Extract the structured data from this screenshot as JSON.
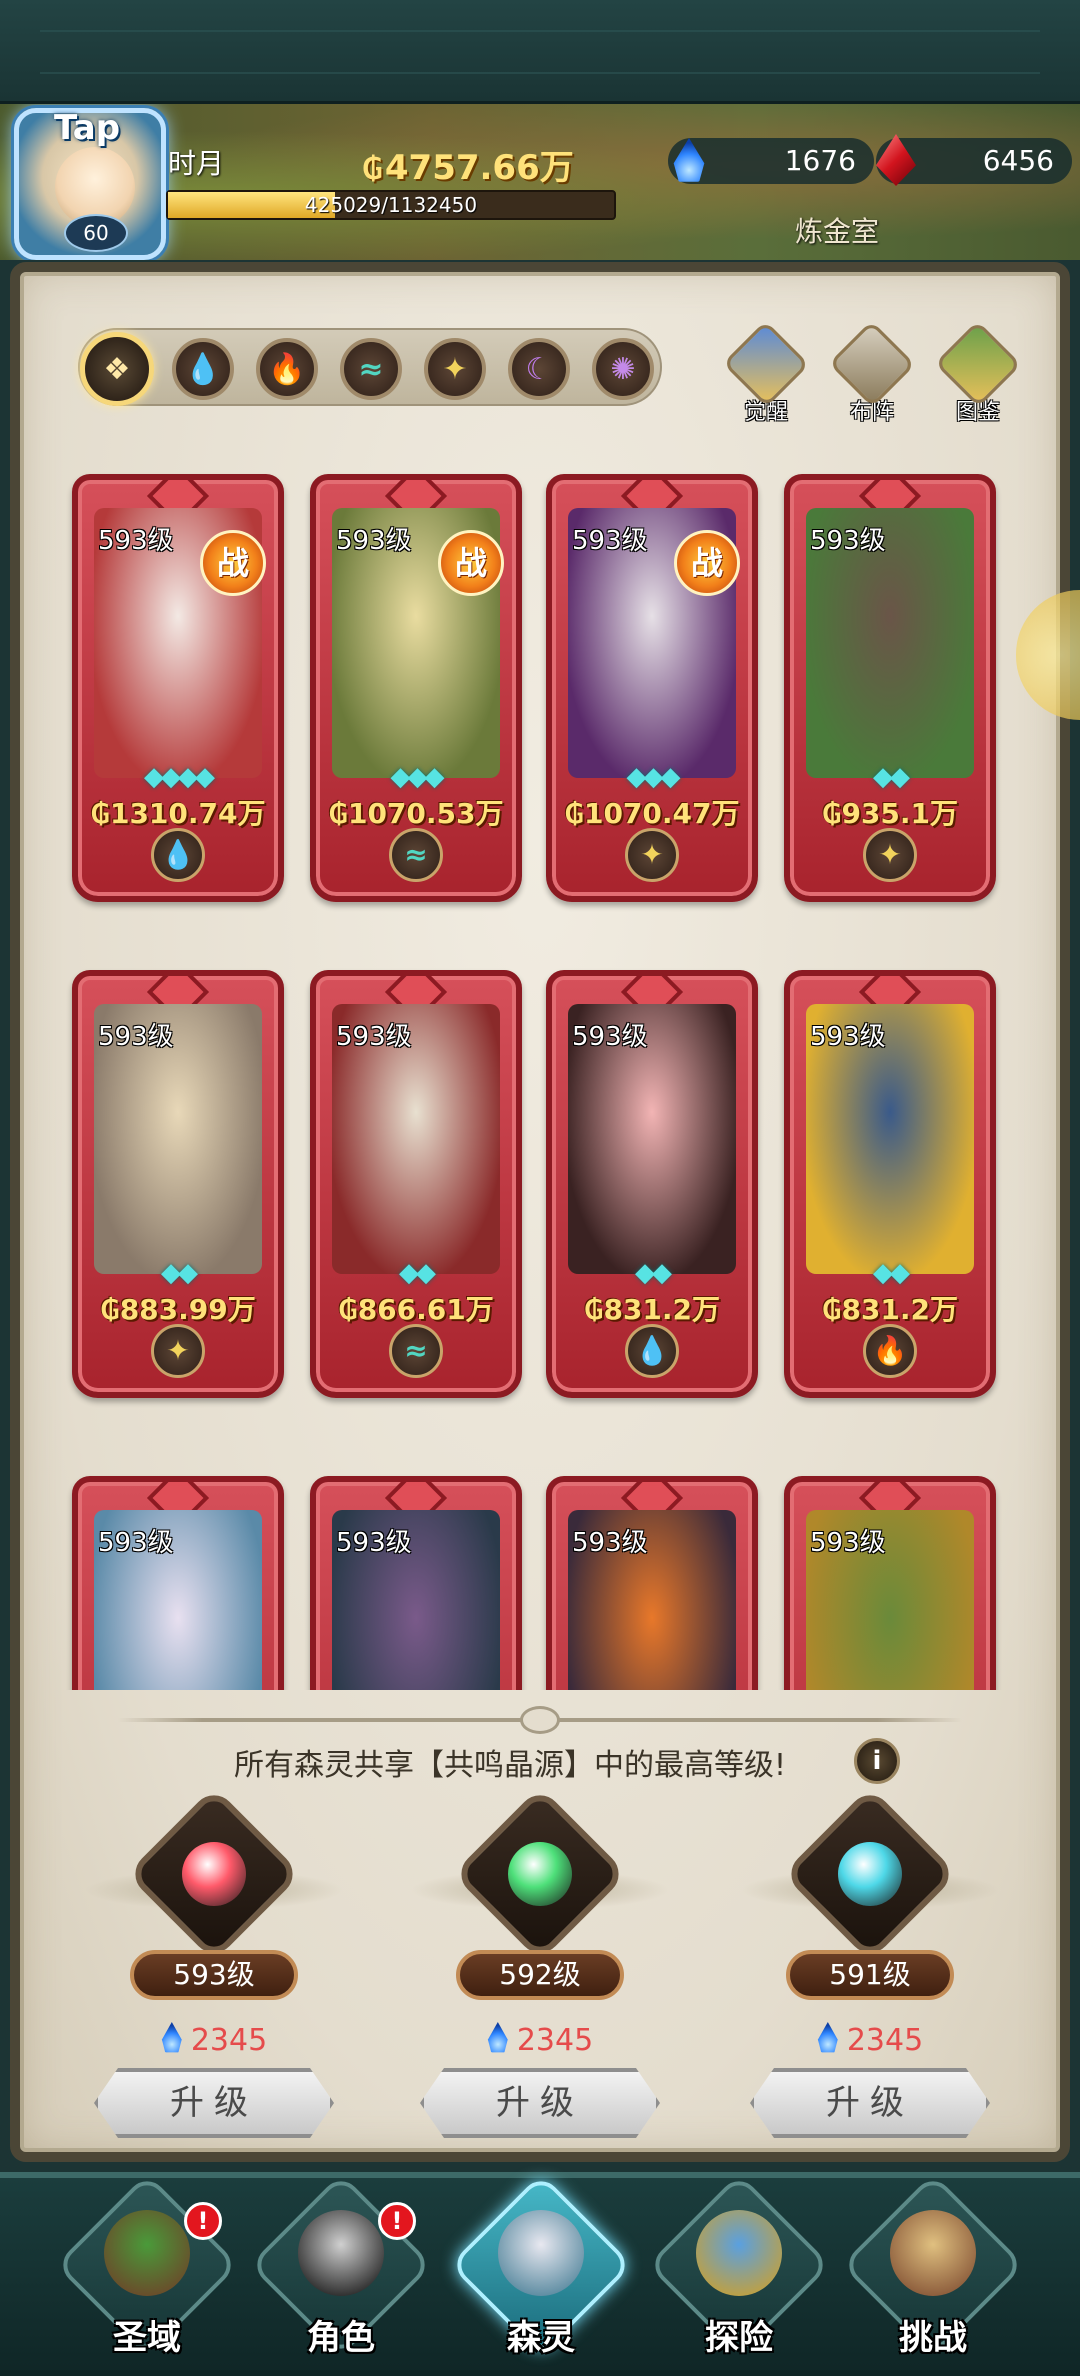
{
  "player": {
    "name": "Tap",
    "level": "60",
    "title_fragment": "时月",
    "gold": "4757.66万",
    "exp": {
      "text": "425029/1132450",
      "fraction": 0.3753
    },
    "energy": "1676",
    "gems": "6456",
    "location": "炼金室"
  },
  "filters": [
    {
      "icon": "all-icon",
      "color": "#ffe9a8",
      "glyph": "❖"
    },
    {
      "icon": "water-element-icon",
      "color": "#5ec8f0",
      "glyph": "💧"
    },
    {
      "icon": "fire-element-icon",
      "color": "#f05a46",
      "glyph": "🔥"
    },
    {
      "icon": "wind-element-icon",
      "color": "#52d6c2",
      "glyph": "≈"
    },
    {
      "icon": "light-element-icon",
      "color": "#f2d35c",
      "glyph": "✦"
    },
    {
      "icon": "dark-element-icon",
      "color": "#c27ef0",
      "glyph": "☾"
    },
    {
      "icon": "void-element-icon",
      "color": "#c48ae8",
      "glyph": "✺"
    }
  ],
  "top_actions": [
    {
      "label": "觉醒",
      "icon": "awaken-icon"
    },
    {
      "label": "布阵",
      "icon": "formation-icon"
    },
    {
      "label": "图鉴",
      "icon": "codex-icon"
    }
  ],
  "heroes": [
    {
      "level": "593级",
      "stars": "◆◆◆◆",
      "power": "1310.74万",
      "in_battle": true,
      "element": "water-element-icon",
      "element_glyph": "💧",
      "element_color": "#5ec8f0",
      "art": [
        "#f3e9e4",
        "#b53a3a"
      ]
    },
    {
      "level": "593级",
      "stars": "◆◆◆",
      "power": "1070.53万",
      "in_battle": true,
      "element": "wind-element-icon",
      "element_glyph": "≈",
      "element_color": "#52d6c2",
      "art": [
        "#e9dca0",
        "#6b7a3a"
      ]
    },
    {
      "level": "593级",
      "stars": "◆◆◆",
      "power": "1070.47万",
      "in_battle": true,
      "element": "light-element-icon",
      "element_glyph": "✦",
      "element_color": "#f2d35c",
      "art": [
        "#e6e0e6",
        "#5a2a6a"
      ]
    },
    {
      "level": "593级",
      "stars": "◆◆",
      "power": "935.1万",
      "in_battle": false,
      "element": "light-element-icon",
      "element_glyph": "✦",
      "element_color": "#f2d35c",
      "art": [
        "#6a5548",
        "#4a7a3a"
      ]
    },
    {
      "level": "593级",
      "stars": "◆◆",
      "power": "883.99万",
      "in_battle": false,
      "element": "light-element-icon",
      "element_glyph": "✦",
      "element_color": "#f2d35c",
      "art": [
        "#e8d8b8",
        "#8a7a6a"
      ]
    },
    {
      "level": "593级",
      "stars": "◆◆",
      "power": "866.61万",
      "in_battle": false,
      "element": "wind-element-icon",
      "element_glyph": "≈",
      "element_color": "#52d6c2",
      "art": [
        "#e8e0d0",
        "#8a2a2a"
      ]
    },
    {
      "level": "593级",
      "stars": "◆◆",
      "power": "831.2万",
      "in_battle": false,
      "element": "water-element-icon",
      "element_glyph": "💧",
      "element_color": "#5ec8f0",
      "art": [
        "#f2b4b4",
        "#3a2222"
      ]
    },
    {
      "level": "593级",
      "stars": "◆◆",
      "power": "831.2万",
      "in_battle": false,
      "element": "fire-element-icon",
      "element_glyph": "🔥",
      "element_color": "#f05a46",
      "art": [
        "#3a5a8a",
        "#e0b030"
      ]
    },
    {
      "level": "593级",
      "art": [
        "#e8e0f0",
        "#5a8aa8"
      ]
    },
    {
      "level": "593级",
      "art": [
        "#7a5a8a",
        "#2a3a4a"
      ]
    },
    {
      "level": "593级",
      "art": [
        "#e8782a",
        "#3a2a3a"
      ]
    },
    {
      "level": "593级",
      "art": [
        "#6a8a3a",
        "#b0882a"
      ]
    }
  ],
  "resonance": {
    "info": "所有森灵共享【共鸣晶源】中的最高等级!",
    "info_icon": "i",
    "crystals": [
      {
        "level": "593级",
        "cost": "2345",
        "button": "升级",
        "core": "#ff5a6a"
      },
      {
        "level": "592级",
        "cost": "2345",
        "button": "升级",
        "core": "#4ee07a"
      },
      {
        "level": "591级",
        "cost": "2345",
        "button": "升级",
        "core": "#4ed8e8"
      }
    ]
  },
  "nav": [
    {
      "label": "圣域",
      "icon": "sanctuary-tree-icon",
      "alert": "!",
      "active": false,
      "art": [
        "#4a9a3a",
        "#6a4a2a"
      ]
    },
    {
      "label": "角色",
      "icon": "character-icon",
      "alert": "!",
      "active": false,
      "art": [
        "#d0d0d0",
        "#2a2a2a"
      ]
    },
    {
      "label": "森灵",
      "icon": "forest-spirit-icon",
      "alert": "",
      "active": true,
      "art": [
        "#e8e8f0",
        "#5a8aa0"
      ]
    },
    {
      "label": "探险",
      "icon": "adventure-shield-icon",
      "alert": "",
      "active": false,
      "art": [
        "#5aa0e0",
        "#c0a040"
      ]
    },
    {
      "label": "挑战",
      "icon": "challenge-icon",
      "alert": "",
      "active": false,
      "art": [
        "#e0c080",
        "#8a5a3a"
      ]
    }
  ],
  "colors": {
    "accent_gold": "#ffe27a",
    "card_red": "#c2323c",
    "cost_red": "#e54b4b"
  }
}
